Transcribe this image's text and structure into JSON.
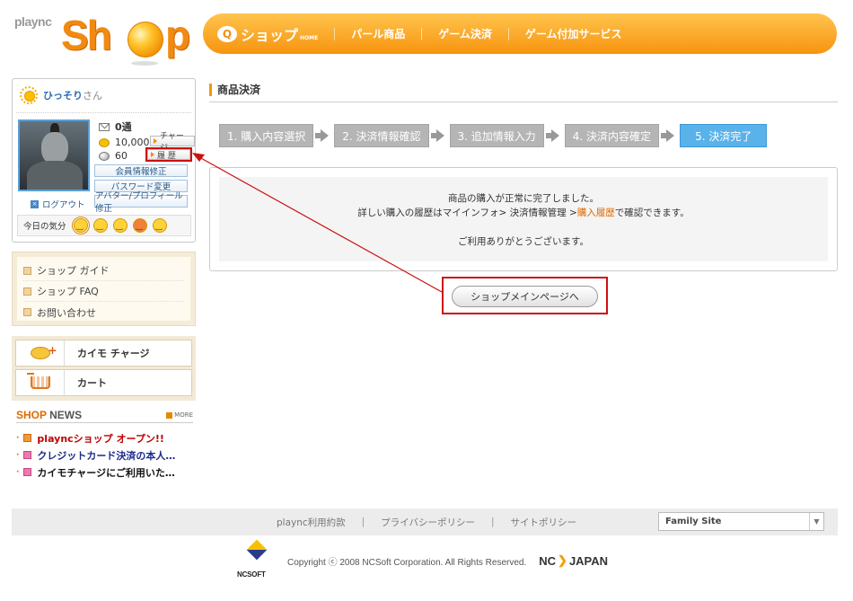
{
  "header": {
    "logo_small": "plaync",
    "logo_main": "Sh",
    "logo_end": "p",
    "shop_tab": "ショップ",
    "shop_tab_tag": "HOME",
    "nav": [
      "パール商品",
      "ゲーム決済",
      "ゲーム付加サービス"
    ]
  },
  "user": {
    "name": "ひっそり",
    "suffix": "さん",
    "mail_count": "0通",
    "coins": "10,000",
    "pearls": "60",
    "charge_btn": "チャージ",
    "history_btn": "履 歴",
    "actions": [
      "会員情報修正",
      "パスワード変更",
      "アバター/プロフィール修正"
    ],
    "logout": "ログアウト",
    "mood_label": "今日の気分"
  },
  "guide": {
    "items": [
      "ショップ ガイド",
      "ショップ FAQ",
      "お問い合わせ"
    ]
  },
  "quick": {
    "charge": "カイモ チャージ",
    "cart": "カート"
  },
  "news": {
    "title_a": "SHOP",
    "title_b": " NEWS",
    "more": "MORE",
    "items": [
      {
        "text": "playncショップ オープン!!",
        "color": "#c00000"
      },
      {
        "text": "クレジットカード決済の本人…",
        "color": "#1a2a8a"
      },
      {
        "text": "カイモチャージにご利用いた…",
        "color": "#111111"
      }
    ]
  },
  "main": {
    "title": "商品決済",
    "steps": [
      "1. 購入内容選択",
      "2. 決済情報確認",
      "3. 追加情報入力",
      "4. 決済内容確定",
      "5. 決済完了"
    ],
    "active_step": 4,
    "message_line1": "商品の購入が正常に完了しました。",
    "message_line2_pre": "詳しい購入の履歴はマイインフォ> 決済情報管理 >",
    "message_line2_link": "購入履歴",
    "message_line2_post": "で確認できます。",
    "message_line3": "ご利用ありがとうございます。",
    "main_page_button": "ショップメインページへ"
  },
  "footer": {
    "links": [
      "plaync利用約款",
      "プライバシーポリシー",
      "サイトポリシー"
    ],
    "family_site": "Family Site",
    "ncsoft": "NCSOFT",
    "copyright": "Copyright ⓒ 2008 NCSoft Corporation. All Rights Reserved.",
    "nc_japan_a": "NC",
    "nc_japan_b": "JAPAN"
  },
  "colors": {
    "accent_orange": "#f7940f",
    "active_step": "#5ab2ea",
    "annotation_red": "#cc1010"
  }
}
